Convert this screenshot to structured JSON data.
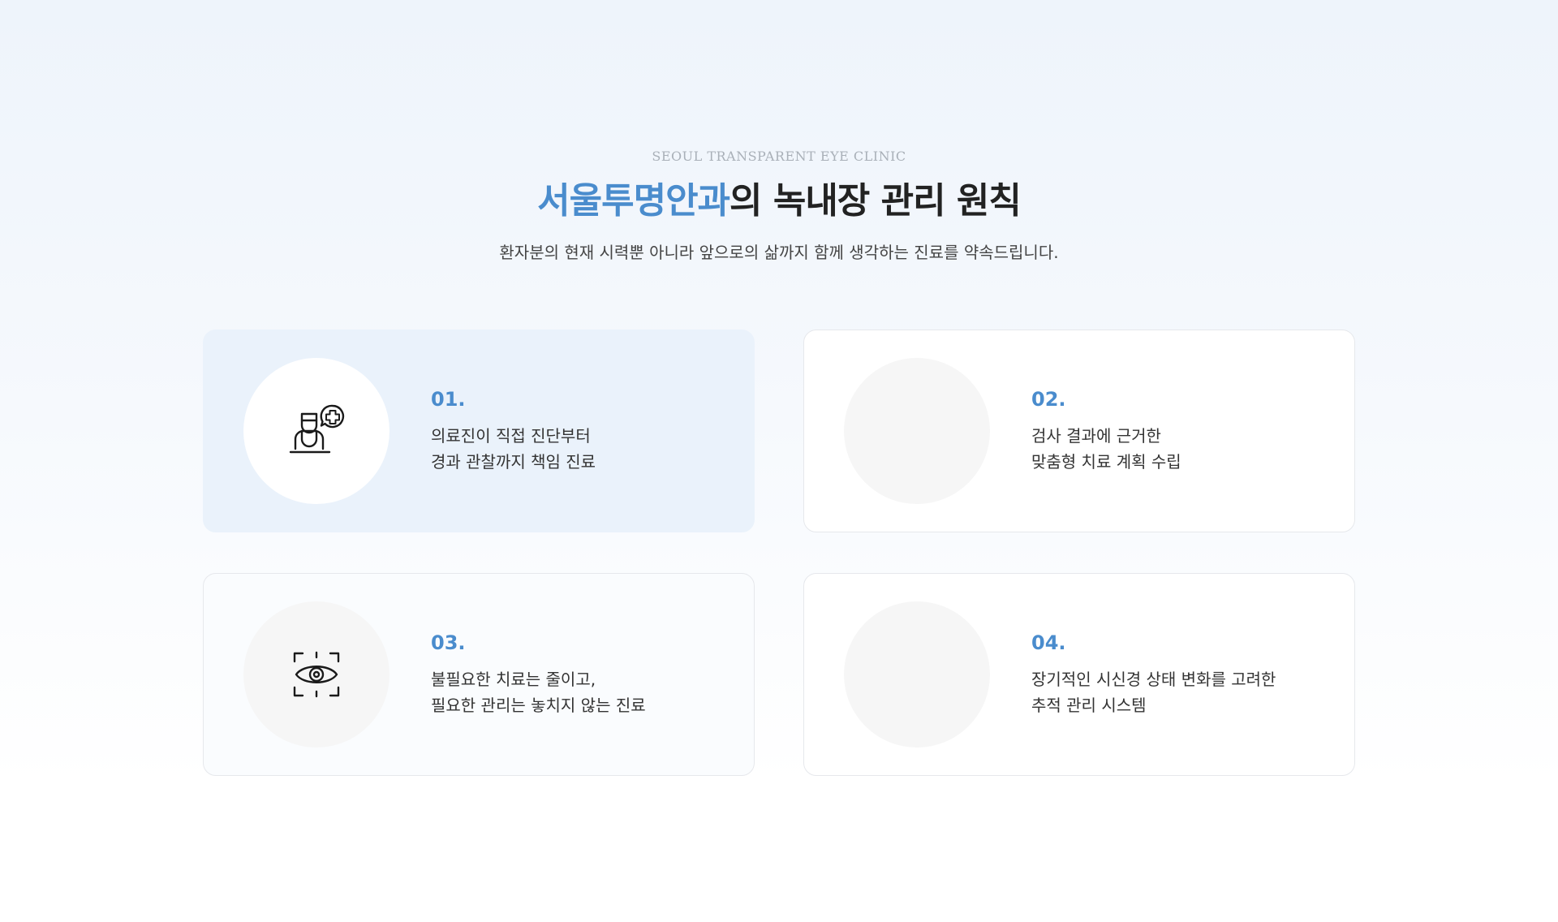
{
  "header": {
    "eyebrow": "SEOUL TRANSPARENT EYE CLINIC",
    "title_accent": "서울투명안과",
    "title_rest": "의 녹내장 관리 원칙",
    "subtitle": "환자분의 현재 시력뿐 아니라 앞으로의 삶까지 함께 생각하는 진료를 약속드립니다."
  },
  "cards": [
    {
      "number": "01.",
      "line1": "의료진이 직접 진단부터",
      "line2": "경과 관찰까지 책임 진료",
      "icon": "doctor-icon"
    },
    {
      "number": "02.",
      "line1": "검사 결과에 근거한",
      "line2": "맞춤형 치료 계획 수립",
      "icon": "none"
    },
    {
      "number": "03.",
      "line1": "불필요한 치료는 줄이고,",
      "line2": "필요한 관리는 놓치지 않는 진료",
      "icon": "eye-scan-icon"
    },
    {
      "number": "04.",
      "line1": "장기적인 시신경 상태 변화를 고려한",
      "line2": "추적 관리 시스템",
      "icon": "none"
    }
  ],
  "colors": {
    "accent": "#4a8ccd",
    "active_card_bg": "#eaf2fb",
    "text": "#333333"
  }
}
